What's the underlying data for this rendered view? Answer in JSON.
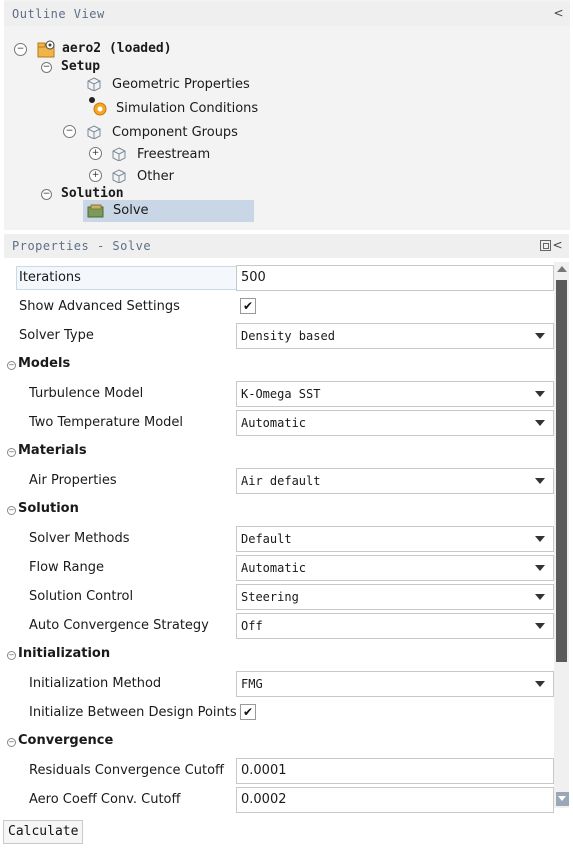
{
  "outline": {
    "title": "Outline View",
    "collapse_glyph": "<",
    "root": "aero2 (loaded)",
    "setup": "Setup",
    "geometric": "Geometric Properties",
    "simulation": "Simulation Conditions",
    "component_groups": "Component Groups",
    "freestream": "Freestream",
    "other": "Other",
    "solution": "Solution",
    "solve": "Solve",
    "toggle_minus": "−",
    "toggle_plus": "+"
  },
  "properties": {
    "title": "Properties - Solve",
    "collapse_glyph": "<",
    "rows": {
      "iterations": {
        "label": "Iterations",
        "value": "500"
      },
      "advanced": {
        "label": "Show Advanced Settings",
        "checked": "✔"
      },
      "solver_type": {
        "label": "Solver Type",
        "value": "Density based"
      },
      "models": {
        "label": "Models"
      },
      "turbulence": {
        "label": "Turbulence Model",
        "value": "K-Omega SST"
      },
      "two_temp": {
        "label": "Two Temperature Model",
        "value": "Automatic"
      },
      "materials": {
        "label": "Materials"
      },
      "air": {
        "label": "Air Properties",
        "value": "Air default"
      },
      "solution": {
        "label": "Solution"
      },
      "solver_methods": {
        "label": "Solver Methods",
        "value": "Default"
      },
      "flow_range": {
        "label": "Flow Range",
        "value": "Automatic"
      },
      "solution_control": {
        "label": "Solution Control",
        "value": "Steering"
      },
      "auto_conv": {
        "label": "Auto Convergence Strategy",
        "value": "Off"
      },
      "initialization": {
        "label": "Initialization"
      },
      "init_method": {
        "label": "Initialization Method",
        "value": "FMG"
      },
      "init_between": {
        "label": "Initialize Between Design Points",
        "checked": "✔"
      },
      "convergence": {
        "label": "Convergence"
      },
      "residuals": {
        "label": "Residuals Convergence Cutoff",
        "value": "0.0001"
      },
      "aero_coeff": {
        "label": "Aero Coeff Conv. Cutoff",
        "value": "0.0002"
      }
    }
  },
  "calculate_label": "Calculate"
}
